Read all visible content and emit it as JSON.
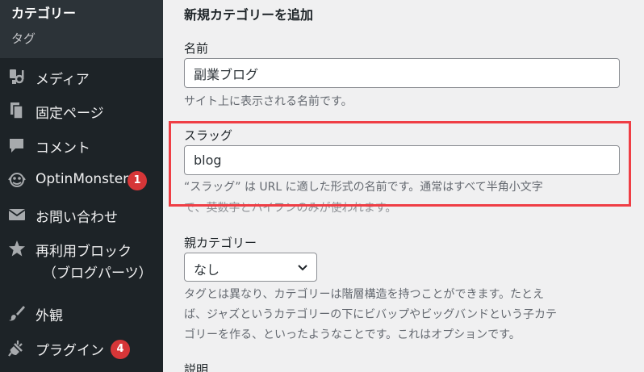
{
  "sidebar": {
    "submenu": {
      "current": "カテゴリー",
      "item": "タグ"
    },
    "items": [
      {
        "label": "メディア",
        "icon": "media-icon"
      },
      {
        "label": "固定ページ",
        "icon": "pages-icon"
      },
      {
        "label": "コメント",
        "icon": "comment-icon"
      },
      {
        "label": "OptinMonster",
        "icon": "optinmonster-icon",
        "badge": "1"
      },
      {
        "label": "お問い合わせ",
        "icon": "mail-icon"
      },
      {
        "label": "再利用ブロック",
        "label2": "（ブログパーツ）",
        "icon": "star-icon"
      },
      {
        "label": "外観",
        "icon": "brush-icon"
      },
      {
        "label": "プラグイン",
        "icon": "plugin-icon",
        "badge": "4"
      }
    ]
  },
  "form": {
    "heading": "新規カテゴリーを追加",
    "name": {
      "label": "名前",
      "value": "副業ブログ",
      "help": "サイト上に表示される名前です。"
    },
    "slug": {
      "label": "スラッグ",
      "value": "blog",
      "help_line1": "“スラッグ” は URL に適した形式の名前です。通常はすべて半角小文字",
      "help_line2": "で、英数字とハイフンのみが使われます。"
    },
    "parent": {
      "label": "親カテゴリー",
      "value": "なし",
      "help_line1": "タグとは異なり、カテゴリーは階層構造を持つことができます。たとえ",
      "help_line2": "ば、ジャズというカテゴリーの下にビバップやビッグバンドという子カテ",
      "help_line3": "ゴリーを作る、といったようなことです。これはオプションです。"
    },
    "description": {
      "label": "説明"
    }
  },
  "colors": {
    "highlight": "#ef3e45",
    "badge": "#d63638",
    "sidebar": "#1d2327"
  }
}
